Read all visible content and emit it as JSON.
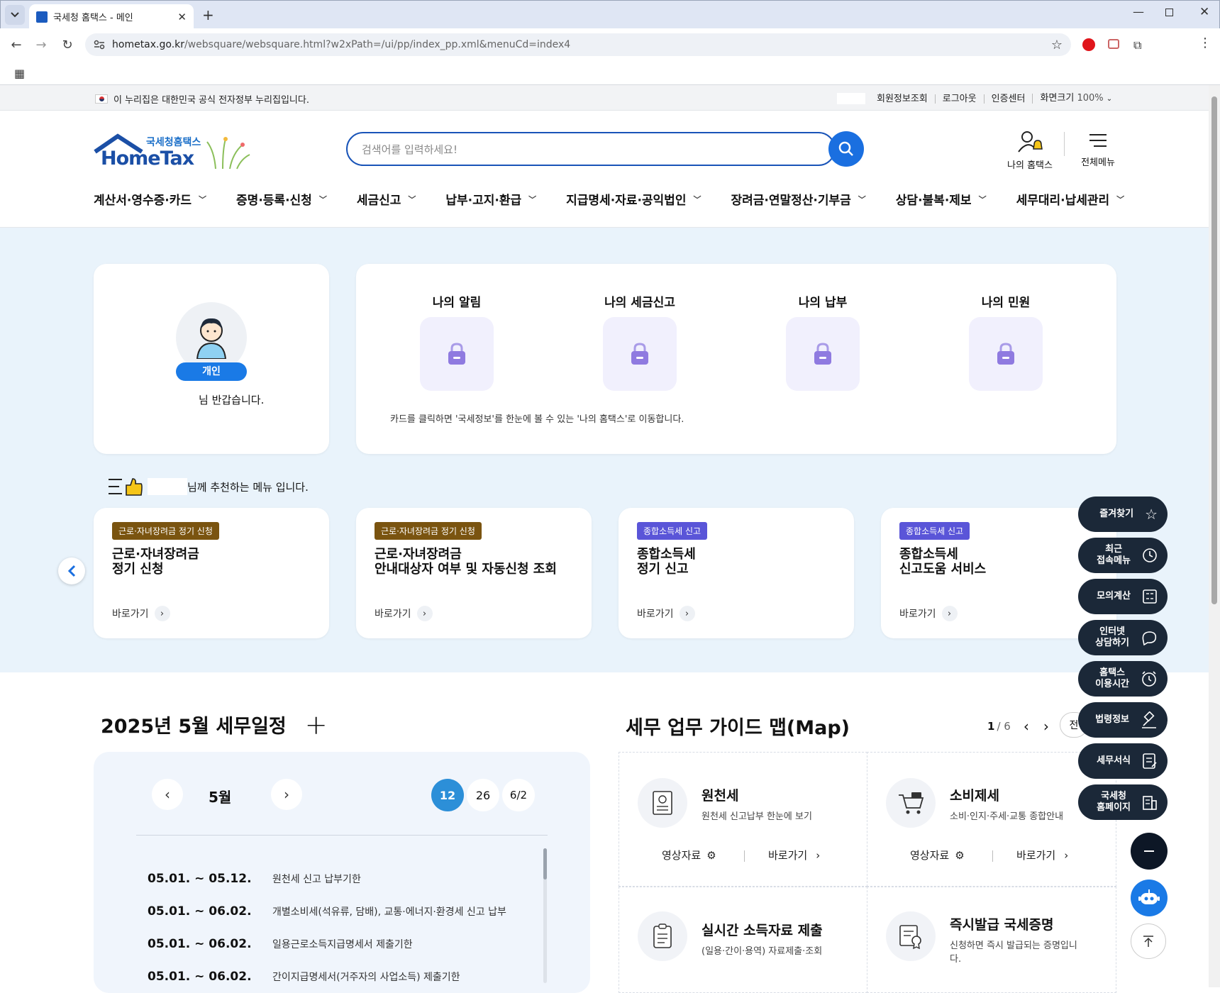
{
  "browser": {
    "tab_title": "국세청 홈택스 - 메인",
    "url_host": "hometax.go.kr",
    "url_path": "/websquare/websquare.html?w2xPath=/ui/pp/index_pp.xml&menuCd=index4"
  },
  "gov_notice": "이 누리집은 대한민국 공식 전자정부 누리집입니다.",
  "top_links": [
    "회원정보조회",
    "로그아웃",
    "인증센터",
    "화면크기"
  ],
  "zoom": "100%",
  "logo": {
    "kr": "국세청홈택스",
    "en": "HomeTax"
  },
  "search": {
    "placeholder": "검색어를 입력하세요!"
  },
  "header_actions": {
    "my": "나의 홈택스",
    "menu": "전체메뉴"
  },
  "gnb": [
    "계산서·영수증·카드",
    "증명·등록·신청",
    "세금신고",
    "납부·고지·환급",
    "지급명세·자료·공익법인",
    "장려금·연말정산·기부금",
    "상담·불복·제보",
    "세무대리·납세관리"
  ],
  "profile": {
    "badge": "개인",
    "greeting": "님 반갑습니다."
  },
  "my_cards": [
    {
      "title": "나의 알림"
    },
    {
      "title": "나의 세금신고"
    },
    {
      "title": "나의 납부"
    },
    {
      "title": "나의 민원"
    }
  ],
  "my_note": "카드를 클릭하면 '국세정보'를 한눈에 볼 수 있는 '나의 홈택스'로 이동합니다.",
  "recommend": {
    "label": "님께 추천하는 메뉴 입니다.",
    "cards": [
      {
        "tag": "근로·자녀장려금 정기 신청",
        "tag_color": "#7a5410",
        "l1": "근로·자녀장려금",
        "l2": "정기 신청",
        "go": "바로가기"
      },
      {
        "tag": "근로·자녀장려금 정기 신청",
        "tag_color": "#7a5410",
        "l1": "근로·자녀장려금",
        "l2": "안내대상자 여부 및 자동신청 조회",
        "go": "바로가기"
      },
      {
        "tag": "종합소득세 신고",
        "tag_color": "#5a55d8",
        "l1": "종합소득세",
        "l2": "정기 신고",
        "go": "바로가기"
      },
      {
        "tag": "종합소득세 신고",
        "tag_color": "#5a55d8",
        "l1": "종합소득세",
        "l2": "신고도움 서비스",
        "go": "바로가기"
      }
    ]
  },
  "schedule": {
    "title": "2025년 5월 세무일정",
    "month": "5월",
    "days": [
      "12",
      "26",
      "6/2"
    ],
    "items": [
      {
        "date": "05.01. ~ 05.12.",
        "text": "원천세 신고 납부기한"
      },
      {
        "date": "05.01. ~ 06.02.",
        "text": "개별소비세(석유류, 담배), 교통·에너지·환경세 신고 납부"
      },
      {
        "date": "05.01. ~ 06.02.",
        "text": "일용근로소득지급명세서 제출기한"
      },
      {
        "date": "05.01. ~ 06.02.",
        "text": "간이지급명세서(거주자의 사업소득) 제출기한"
      }
    ]
  },
  "guide": {
    "title": "세무 업무 가이드 맵(Map)",
    "page_current": "1",
    "page_total": "/ 6",
    "all_btn": "전",
    "items": [
      {
        "title": "원천세",
        "sub": "원천세 신고납부 한눈에 보기",
        "video": "영상자료",
        "go": "바로가기"
      },
      {
        "title": "소비제세",
        "sub": "소비·인지·주세·교통 종합안내",
        "video": "영상자료",
        "go": "바로가기"
      },
      {
        "title": "실시간 소득자료 제출",
        "sub": "(일용·간이·용역) 자료제출·조회"
      },
      {
        "title": "즉시발급 국세증명",
        "sub": "신청하면 즉시 발급되는 증명입니",
        "sub2": "다."
      }
    ]
  },
  "quick": [
    {
      "l1": "즐겨찾기",
      "l2": "",
      "icon": "star-icon"
    },
    {
      "l1": "최근",
      "l2": "접속메뉴",
      "icon": "clock-icon"
    },
    {
      "l1": "모의계산",
      "l2": "",
      "icon": "calculator-icon"
    },
    {
      "l1": "인터넷",
      "l2": "상담하기",
      "icon": "chat-icon"
    },
    {
      "l1": "홈택스",
      "l2": "이용시간",
      "icon": "alarm-icon"
    },
    {
      "l1": "법령정보",
      "l2": "",
      "icon": "gavel-icon"
    },
    {
      "l1": "세무서식",
      "l2": "",
      "icon": "form-icon"
    },
    {
      "l1": "국세청",
      "l2": "홈페이지",
      "icon": "building-icon"
    }
  ]
}
